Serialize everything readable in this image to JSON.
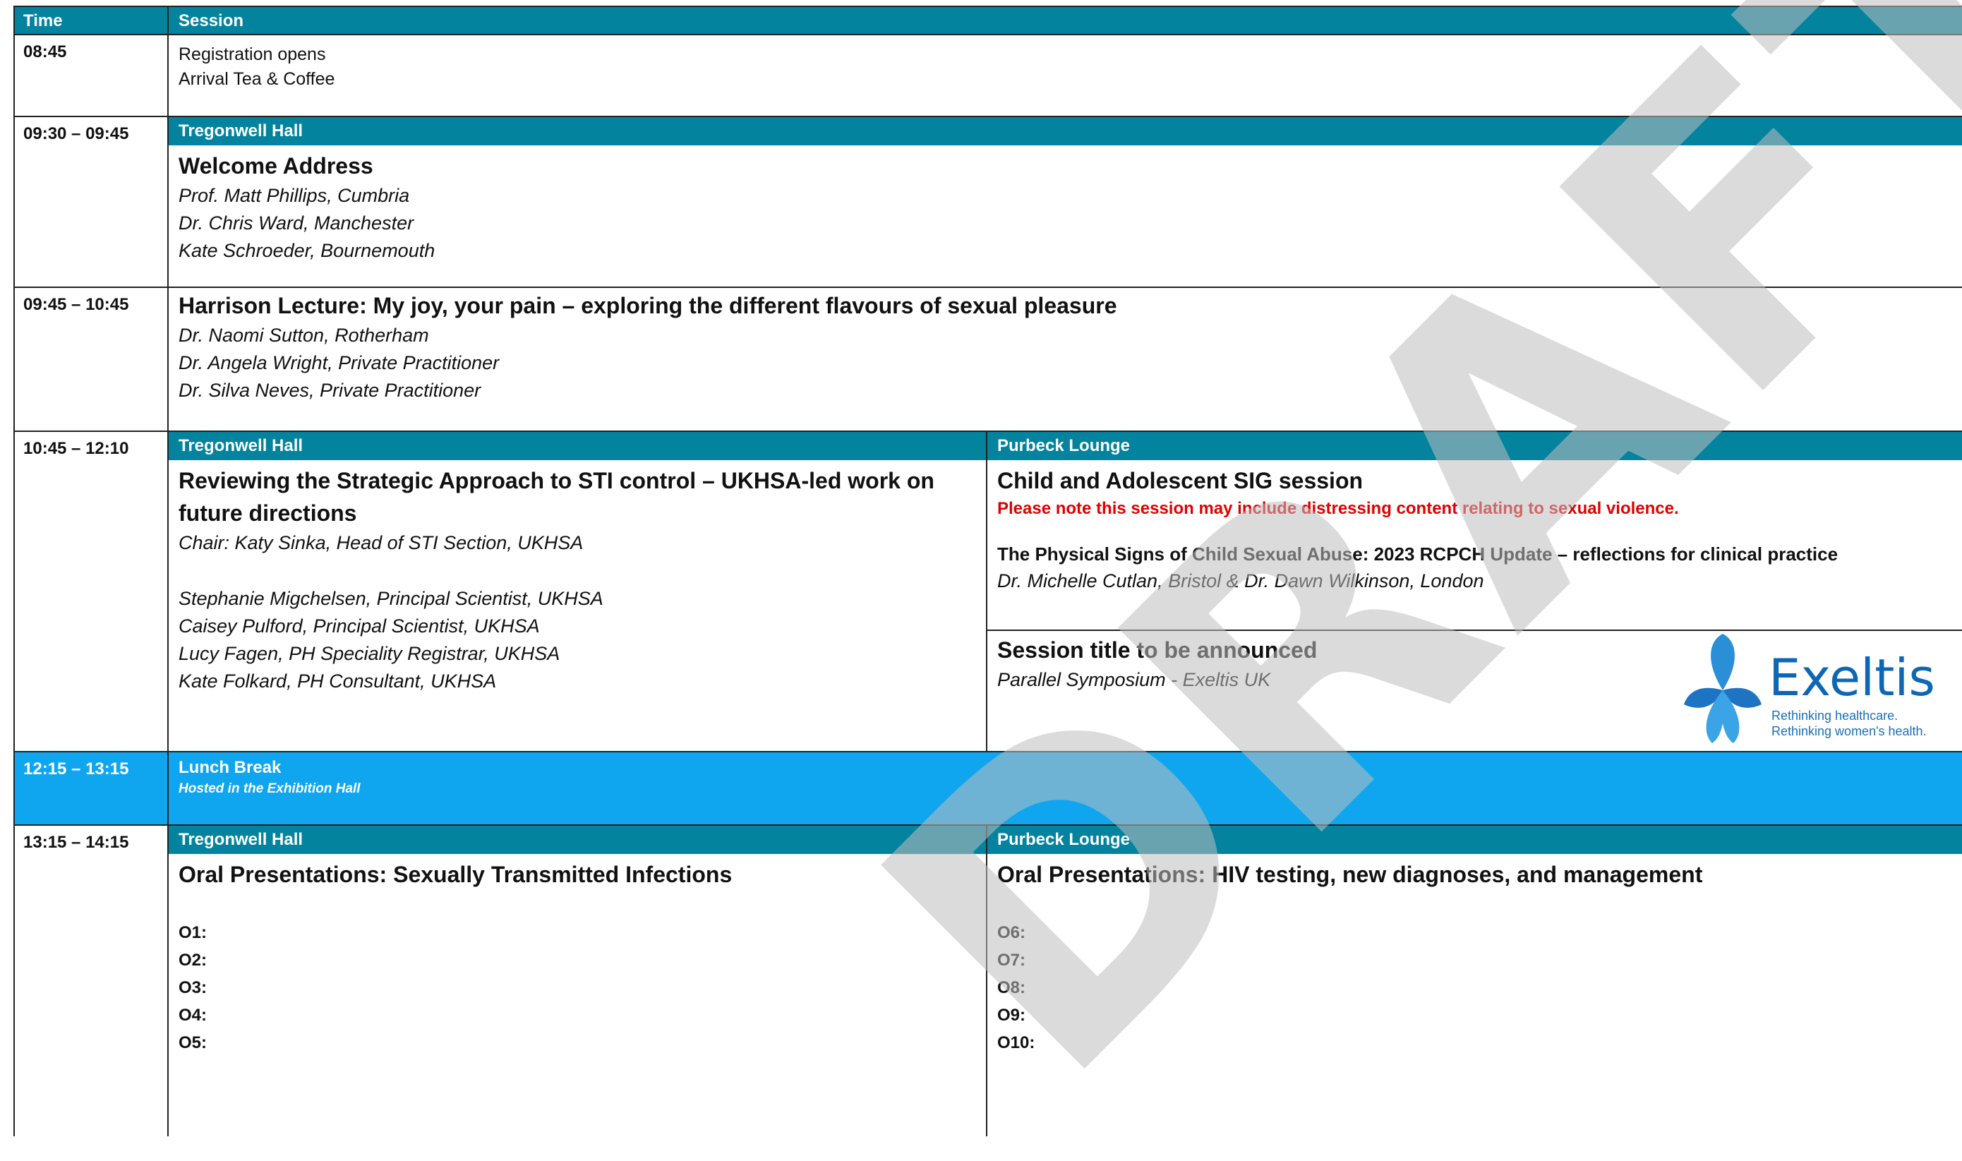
{
  "header": {
    "time": "Time",
    "session": "Session"
  },
  "rows": {
    "r1": {
      "time": "08:45",
      "lines": [
        "Registration opens",
        "Arrival Tea & Coffee"
      ]
    },
    "r2": {
      "time": "09:30 – 09:45",
      "venue": "Tregonwell Hall",
      "title": "Welcome Address",
      "speakers": [
        "Prof. Matt Phillips, Cumbria",
        "Dr. Chris Ward, Manchester",
        "Kate Schroeder, Bournemouth"
      ]
    },
    "r3": {
      "time": "09:45 – 10:45",
      "title": "Harrison Lecture: My joy, your pain – exploring the different flavours of sexual pleasure",
      "speakers": [
        "Dr. Naomi Sutton, Rotherham",
        "Dr. Angela Wright, Private Practitioner",
        "Dr. Silva Neves, Private Practitioner"
      ]
    },
    "r4": {
      "time": "10:45 – 12:10",
      "left": {
        "venue": "Tregonwell Hall",
        "title_l1": "Reviewing the Strategic Approach to STI control – UKHSA-led work on",
        "title_l2": "future directions",
        "chair": "Chair: Katy Sinka, Head of STI Section, UKHSA",
        "speakers": [
          "Stephanie Migchelsen, Principal Scientist, UKHSA",
          "Caisey Pulford, Principal Scientist, UKHSA",
          "Lucy Fagen, PH Speciality Registrar, UKHSA",
          "Kate Folkard, PH Consultant, UKHSA"
        ]
      },
      "right": {
        "venue": "Purbeck Lounge",
        "title": "Child and Adolescent SIG session",
        "warning": "Please note this session may include distressing content relating to sexual violence.",
        "talk": "The Physical Signs of Child Sexual Abuse: 2023 RCPCH Update – reflections for clinical practice",
        "talk_speakers": "Dr. Michelle Cutlan, Bristol & Dr. Dawn Wilkinson, London",
        "title2": "Session title to be announced",
        "subtitle2": "Parallel Symposium - Exeltis UK",
        "logo": {
          "name": "Exeltis",
          "tag1": "Rethinking healthcare.",
          "tag2": "Rethinking women's health."
        }
      }
    },
    "r5": {
      "time": "12:15 – 13:15",
      "title": "Lunch Break",
      "note": "Hosted in the Exhibition Hall"
    },
    "r6": {
      "time": "13:15 – 14:15",
      "left": {
        "venue": "Tregonwell Hall",
        "title": "Oral Presentations: Sexually Transmitted Infections",
        "items": [
          "O1:",
          "O2:",
          "O3:",
          "O4:",
          "O5:"
        ]
      },
      "right": {
        "venue": "Purbeck Lounge",
        "title": "Oral Presentations: HIV testing, new diagnoses, and management",
        "items": [
          "O6:",
          "O7:",
          "O8:",
          "O9:",
          "O10:"
        ]
      }
    }
  },
  "watermark": "DRAFT",
  "colors": {
    "band": "#03839e",
    "lunch": "#0fa6ef",
    "warning": "#e00000",
    "logo": "#0e67b4"
  }
}
